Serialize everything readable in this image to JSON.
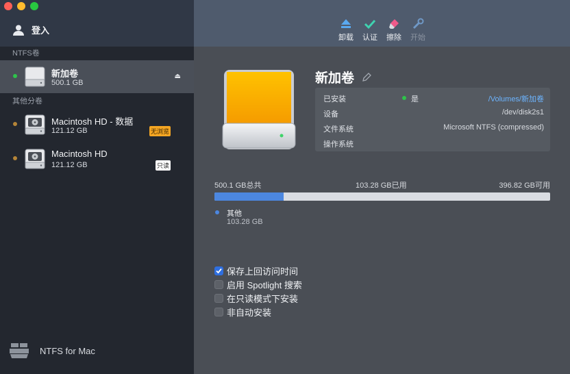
{
  "sidebar": {
    "login_label": "登入",
    "sections": {
      "ntfs_title": "NTFS卷",
      "other_title": "其他分卷"
    },
    "items": [
      {
        "name": "新加卷",
        "size": "500.1 GB",
        "status_color": "#2ec34a"
      },
      {
        "name": "Macintosh HD - 数据",
        "size": "121.12 GB",
        "badge": "无浏览",
        "status_color": "#b58538"
      },
      {
        "name": "Macintosh HD",
        "size": "121.12 GB",
        "badge": "只读",
        "status_color": "#b58538"
      }
    ],
    "brand_label": "NTFS for Mac"
  },
  "toolbar": {
    "unmount_label": "卸载",
    "verify_label": "认证",
    "erase_label": "擦除",
    "start_label": "开始"
  },
  "volume": {
    "title": "新加卷",
    "info": {
      "mounted_label": "已安装",
      "mounted_value": "是",
      "mount_path": "/Volumes/新加卷",
      "device_label": "设备",
      "device_value": "/dev/disk2s1",
      "fs_label": "文件系统",
      "fs_value": "Microsoft NTFS (compressed)",
      "os_label": "操作系统",
      "os_value": ""
    },
    "usage": {
      "total": "500.1 GB总共",
      "used": "103.28 GB已用",
      "free": "396.82 GB可用",
      "used_fraction": 0.2065,
      "legend_name": "其他",
      "legend_value": "103.28 GB"
    }
  },
  "options": [
    {
      "label": "保存上回访问时间",
      "checked": true
    },
    {
      "label": "启用 Spotlight 搜索",
      "checked": false
    },
    {
      "label": "在只读模式下安装",
      "checked": false
    },
    {
      "label": "非自动安装",
      "checked": false
    }
  ],
  "colors": {
    "accent": "#4c87e0",
    "link": "#6cb4ff",
    "badge_bg": "#f5a623"
  }
}
